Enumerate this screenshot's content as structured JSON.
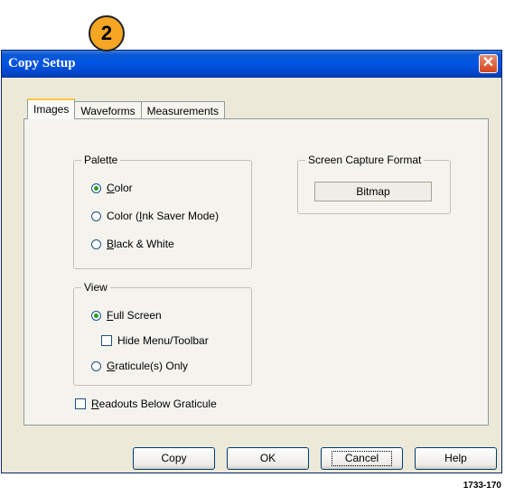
{
  "callout": {
    "number": "2"
  },
  "window": {
    "title": "Copy Setup",
    "close_label": "✕"
  },
  "tabs": [
    {
      "label": "Images",
      "active": true
    },
    {
      "label": "Waveforms",
      "active": false
    },
    {
      "label": "Measurements",
      "active": false
    }
  ],
  "palette": {
    "label": "Palette",
    "options": [
      {
        "pre": "",
        "u": "C",
        "post": "olor",
        "selected": true
      },
      {
        "pre": "Color (",
        "u": "I",
        "post": "nk Saver Mode)",
        "selected": false
      },
      {
        "pre": "",
        "u": "B",
        "post": "lack & White",
        "selected": false
      }
    ]
  },
  "screen_capture": {
    "label": "Screen Capture Format",
    "value": "Bitmap"
  },
  "view": {
    "label": "View",
    "full_screen": {
      "pre": "",
      "u": "F",
      "post": "ull Screen",
      "selected": true
    },
    "hide_menu": {
      "label": "Hide Menu/Toolbar",
      "checked": false
    },
    "graticule_only": {
      "pre": "",
      "u": "G",
      "post": "raticule(s) Only",
      "selected": false
    }
  },
  "readouts": {
    "pre": "",
    "u": "R",
    "post": "eadouts Below Graticule",
    "checked": false
  },
  "buttons": {
    "copy": "Copy",
    "ok": "OK",
    "cancel": "Cancel",
    "help": "Help"
  },
  "figure_id": "1733-170"
}
